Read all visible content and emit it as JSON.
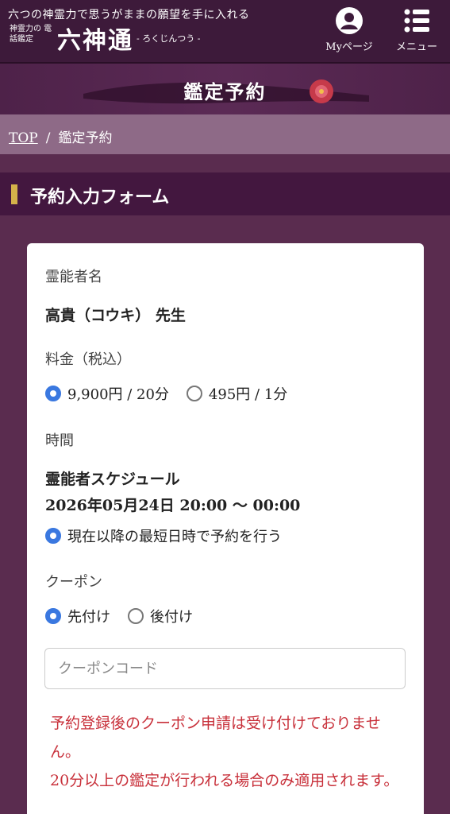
{
  "header": {
    "tagline": "六つの神霊力で思うがままの願望を手に入れる",
    "sub_label": "神霊力の 電話鑑定",
    "logo": "六神通",
    "logo_reading": "- ろくじんつう -",
    "mypage_label": "Myページ",
    "menu_label": "メニュー",
    "mypage_icon": "user-circle-icon",
    "menu_icon": "list-menu-icon"
  },
  "banner": {
    "title": "鑑定予約"
  },
  "breadcrumb": {
    "top": "TOP",
    "separator": "/",
    "current": "鑑定予約"
  },
  "section": {
    "title": "予約入力フォーム"
  },
  "form": {
    "reader_label": "霊能者名",
    "reader_name": "高貴（コウキ） 先生",
    "price_label": "料金（税込）",
    "price_options": [
      {
        "label": "9,900円 / 20分",
        "selected": true
      },
      {
        "label": "495円 / 1分",
        "selected": false
      }
    ],
    "time_label": "時間",
    "schedule_title": "霊能者スケジュール",
    "schedule_value": "2026年05月24日 20:00 ～ 00:00",
    "earliest_option": "現在以降の最短日時で予約を行う",
    "coupon_label": "クーポン",
    "coupon_options": [
      {
        "label": "先付け",
        "selected": true
      },
      {
        "label": "後付け",
        "selected": false
      }
    ],
    "coupon_placeholder": "クーポンコード",
    "notice_1": "予約登録後のクーポン申請は受け付けておりません。",
    "notice_2": "20分以上の鑑定が行われる場合のみ適用されます。"
  },
  "colors": {
    "header_bg": "#3d1a3a",
    "accent_gold": "#d4b24a",
    "radio_blue": "#3a78e0",
    "notice_red": "#c8303a"
  }
}
